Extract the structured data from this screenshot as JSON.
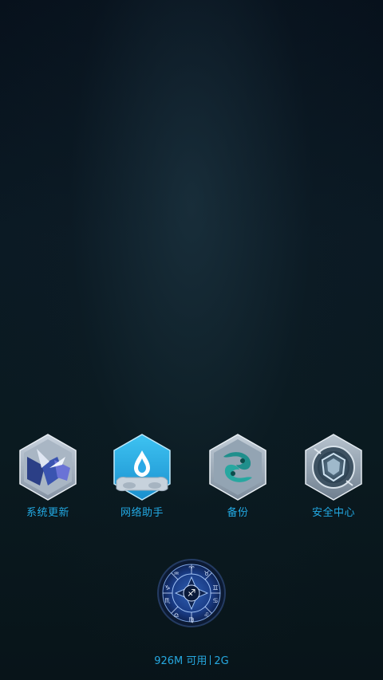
{
  "apps": [
    {
      "label": "系统更新",
      "icon": "system-update-icon"
    },
    {
      "label": "网络助手",
      "icon": "network-assistant-icon"
    },
    {
      "label": "备份",
      "icon": "backup-icon"
    },
    {
      "label": "安全中心",
      "icon": "security-center-icon"
    }
  ],
  "dock": {
    "icon": "zodiac-sagittarius-icon"
  },
  "status": {
    "memory": "926M 可用",
    "network": "2G"
  },
  "colors": {
    "label": "#22a9e3",
    "background": "#0a1a22"
  }
}
